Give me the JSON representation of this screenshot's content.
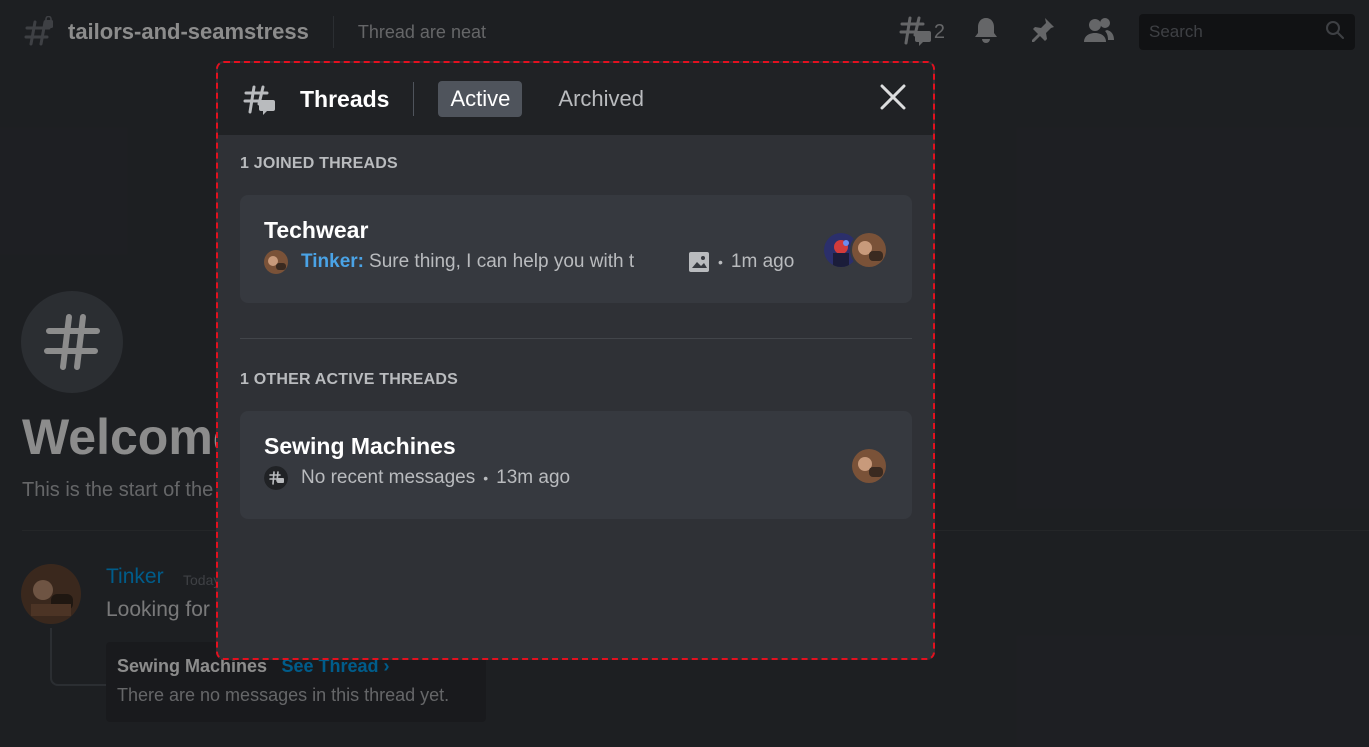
{
  "channel": {
    "name": "tailors-and-seamstress",
    "topic": "Thread are neat",
    "thread_count": "2",
    "search_placeholder": "Search"
  },
  "welcome": {
    "title": "Welcome to #tailors-and-seamstress!",
    "subtitle": "This is the start of the #tailors-and-seamstress channel."
  },
  "message": {
    "author": "Tinker",
    "timestamp": "Today",
    "text": "Looking for",
    "thread_card": {
      "name": "Sewing Machines",
      "link": "See Thread ›",
      "empty": "There are no messages in this thread yet."
    }
  },
  "popout": {
    "title": "Threads",
    "tabs": [
      {
        "label": "Active",
        "selected": true
      },
      {
        "label": "Archived",
        "selected": false
      }
    ],
    "sections": [
      {
        "label": "1 JOINED THREADS",
        "threads": [
          {
            "name": "Techwear",
            "author": "Tinker:",
            "preview": "Sure thing, I can help you with t",
            "ago": "1m ago",
            "has_image_attachment": true,
            "member_avatars": 2
          }
        ]
      },
      {
        "label": "1 OTHER ACTIVE THREADS",
        "threads": [
          {
            "name": "Sewing Machines",
            "preview": "No recent messages",
            "ago": "13m ago",
            "member_avatars": 1
          }
        ]
      }
    ]
  },
  "colors": {
    "background": "#36393f",
    "popout_header": "#202225",
    "popout_body": "#2f3136",
    "card": "#36393f",
    "accent_link": "#00a8fc",
    "highlight_border": "#e4101f"
  }
}
